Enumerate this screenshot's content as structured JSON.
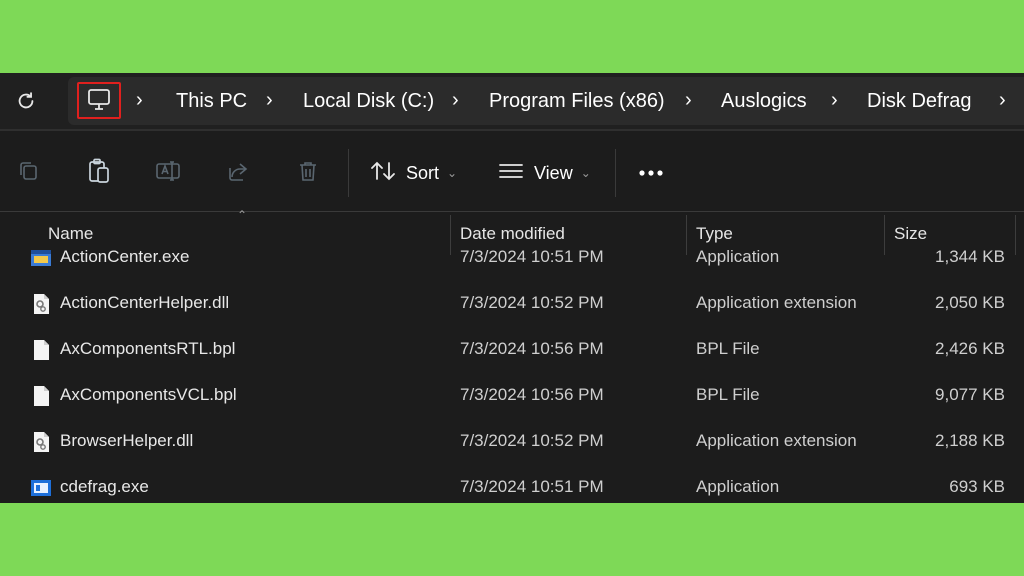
{
  "breadcrumb": [
    "This PC",
    "Local Disk (C:)",
    "Program Files (x86)",
    "Auslogics",
    "Disk Defrag"
  ],
  "toolbar": {
    "sort_label": "Sort",
    "view_label": "View",
    "paste_highlight_color": "#e0201e"
  },
  "columns": {
    "name": "Name",
    "date": "Date modified",
    "type": "Type",
    "size": "Size"
  },
  "files": [
    {
      "name": "ActionCenter.exe",
      "date": "7/3/2024 10:51 PM",
      "type": "Application",
      "size": "1,344 KB",
      "icon": "app-window-icon"
    },
    {
      "name": "ActionCenterHelper.dll",
      "date": "7/3/2024 10:52 PM",
      "type": "Application extension",
      "size": "2,050 KB",
      "icon": "dll-gear-icon"
    },
    {
      "name": "AxComponentsRTL.bpl",
      "date": "7/3/2024 10:56 PM",
      "type": "BPL File",
      "size": "2,426 KB",
      "icon": "blank-file-icon"
    },
    {
      "name": "AxComponentsVCL.bpl",
      "date": "7/3/2024 10:56 PM",
      "type": "BPL File",
      "size": "9,077 KB",
      "icon": "blank-file-icon"
    },
    {
      "name": "BrowserHelper.dll",
      "date": "7/3/2024 10:52 PM",
      "type": "Application extension",
      "size": "2,188 KB",
      "icon": "dll-gear-icon"
    },
    {
      "name": "cdefrag.exe",
      "date": "7/3/2024 10:51 PM",
      "type": "Application",
      "size": "693 KB",
      "icon": "app-window-icon"
    }
  ],
  "colors": {
    "background": "#7ed957",
    "window": "#1c1c1c"
  }
}
